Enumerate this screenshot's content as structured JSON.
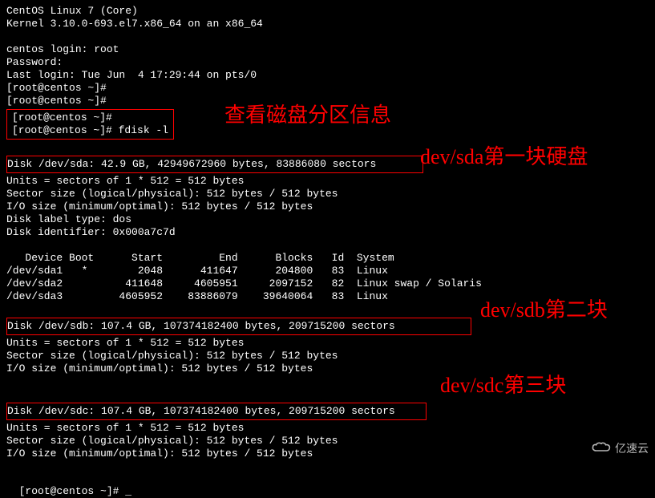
{
  "header": {
    "os_line": "CentOS Linux 7 (Core)",
    "kernel_line": "Kernel 3.10.0-693.el7.x86_64 on an x86_64"
  },
  "login": {
    "login_line": "centos login: root",
    "password_line": "Password:",
    "last_login_line": "Last login: Tue Jun  4 17:29:44 on pts/0"
  },
  "prompts": {
    "p1": "[root@centos ~]#",
    "p2": "[root@centos ~]#",
    "p3": "[root@centos ~]#",
    "p4_cmd": "[root@centos ~]# fdisk -l",
    "p_end": "[root@centos ~]# ",
    "cursor": "_"
  },
  "disk_sda": {
    "header": "Disk /dev/sda: 42.9 GB, 42949672960 bytes, 83886080 sectors",
    "units": "Units = sectors of 1 * 512 = 512 bytes",
    "sector_size": "Sector size (logical/physical): 512 bytes / 512 bytes",
    "io_size": "I/O size (minimum/optimal): 512 bytes / 512 bytes",
    "label_type": "Disk label type: dos",
    "identifier": "Disk identifier: 0x000a7c7d"
  },
  "partition_table": {
    "header": "   Device Boot      Start         End      Blocks   Id  System",
    "row1": "/dev/sda1   *        2048      411647      204800   83  Linux",
    "row2": "/dev/sda2          411648     4605951     2097152   82  Linux swap / Solaris",
    "row3": "/dev/sda3         4605952    83886079    39640064   83  Linux"
  },
  "disk_sdb": {
    "header": "Disk /dev/sdb: 107.4 GB, 107374182400 bytes, 209715200 sectors",
    "units": "Units = sectors of 1 * 512 = 512 bytes",
    "sector_size": "Sector size (logical/physical): 512 bytes / 512 bytes",
    "io_size": "I/O size (minimum/optimal): 512 bytes / 512 bytes"
  },
  "disk_sdc": {
    "header": "Disk /dev/sdc: 107.4 GB, 107374182400 bytes, 209715200 sectors",
    "units": "Units = sectors of 1 * 512 = 512 bytes",
    "sector_size": "Sector size (logical/physical): 512 bytes / 512 bytes",
    "io_size": "I/O size (minimum/optimal): 512 bytes / 512 bytes"
  },
  "annotations": {
    "anno1": "查看磁盘分区信息",
    "anno2": "dev/sda第一块硬盘",
    "anno3": "dev/sdb第二块",
    "anno4": "dev/sdc第三块"
  },
  "watermark": {
    "text": "亿速云"
  }
}
